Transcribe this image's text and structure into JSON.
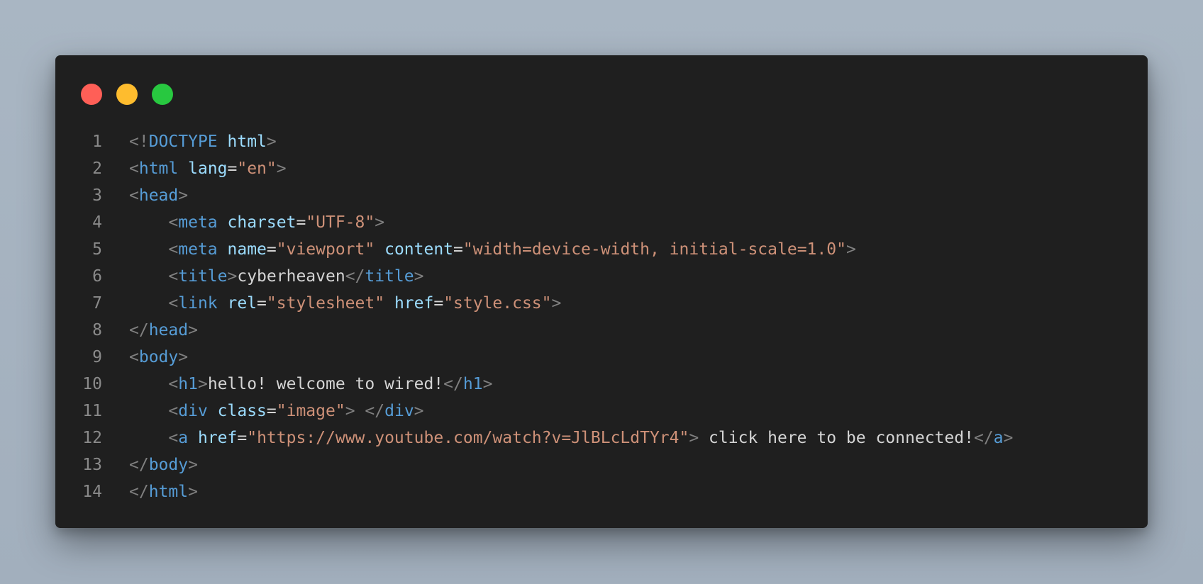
{
  "window": {
    "traffic_lights": [
      {
        "name": "close",
        "color": "#ff5f57"
      },
      {
        "name": "minimize",
        "color": "#febc2e"
      },
      {
        "name": "zoom",
        "color": "#28c840"
      }
    ]
  },
  "colors": {
    "background": "#a9b6c3",
    "editor_bg": "#1f1f1f",
    "line_number": "#8a8a8a",
    "punctuation": "#808080",
    "tag": "#569cd6",
    "attribute": "#9cdcfe",
    "string": "#ce9178",
    "text": "#d4d4d4"
  },
  "code_lines": [
    {
      "n": "1",
      "tokens": [
        {
          "t": "<!",
          "c": "p"
        },
        {
          "t": "DOCTYPE",
          "c": "t"
        },
        {
          "t": " ",
          "c": "x"
        },
        {
          "t": "html",
          "c": "a"
        },
        {
          "t": ">",
          "c": "p"
        }
      ]
    },
    {
      "n": "2",
      "tokens": [
        {
          "t": "<",
          "c": "p"
        },
        {
          "t": "html",
          "c": "t"
        },
        {
          "t": " ",
          "c": "x"
        },
        {
          "t": "lang",
          "c": "a"
        },
        {
          "t": "=",
          "c": "x"
        },
        {
          "t": "\"en\"",
          "c": "s"
        },
        {
          "t": ">",
          "c": "p"
        }
      ]
    },
    {
      "n": "3",
      "tokens": [
        {
          "t": "<",
          "c": "p"
        },
        {
          "t": "head",
          "c": "t"
        },
        {
          "t": ">",
          "c": "p"
        }
      ]
    },
    {
      "n": "4",
      "tokens": [
        {
          "t": "    ",
          "c": "x"
        },
        {
          "t": "<",
          "c": "p"
        },
        {
          "t": "meta",
          "c": "t"
        },
        {
          "t": " ",
          "c": "x"
        },
        {
          "t": "charset",
          "c": "a"
        },
        {
          "t": "=",
          "c": "x"
        },
        {
          "t": "\"UTF-8\"",
          "c": "s"
        },
        {
          "t": ">",
          "c": "p"
        }
      ]
    },
    {
      "n": "5",
      "tokens": [
        {
          "t": "    ",
          "c": "x"
        },
        {
          "t": "<",
          "c": "p"
        },
        {
          "t": "meta",
          "c": "t"
        },
        {
          "t": " ",
          "c": "x"
        },
        {
          "t": "name",
          "c": "a"
        },
        {
          "t": "=",
          "c": "x"
        },
        {
          "t": "\"viewport\"",
          "c": "s"
        },
        {
          "t": " ",
          "c": "x"
        },
        {
          "t": "content",
          "c": "a"
        },
        {
          "t": "=",
          "c": "x"
        },
        {
          "t": "\"width=device-width, initial-scale=1.0\"",
          "c": "s"
        },
        {
          "t": ">",
          "c": "p"
        }
      ]
    },
    {
      "n": "6",
      "tokens": [
        {
          "t": "    ",
          "c": "x"
        },
        {
          "t": "<",
          "c": "p"
        },
        {
          "t": "title",
          "c": "t"
        },
        {
          "t": ">",
          "c": "p"
        },
        {
          "t": "cyberheaven",
          "c": "x"
        },
        {
          "t": "</",
          "c": "p"
        },
        {
          "t": "title",
          "c": "t"
        },
        {
          "t": ">",
          "c": "p"
        }
      ]
    },
    {
      "n": "7",
      "tokens": [
        {
          "t": "    ",
          "c": "x"
        },
        {
          "t": "<",
          "c": "p"
        },
        {
          "t": "link",
          "c": "t"
        },
        {
          "t": " ",
          "c": "x"
        },
        {
          "t": "rel",
          "c": "a"
        },
        {
          "t": "=",
          "c": "x"
        },
        {
          "t": "\"stylesheet\"",
          "c": "s"
        },
        {
          "t": " ",
          "c": "x"
        },
        {
          "t": "href",
          "c": "a"
        },
        {
          "t": "=",
          "c": "x"
        },
        {
          "t": "\"style.css\"",
          "c": "s"
        },
        {
          "t": ">",
          "c": "p"
        }
      ]
    },
    {
      "n": "8",
      "tokens": [
        {
          "t": "</",
          "c": "p"
        },
        {
          "t": "head",
          "c": "t"
        },
        {
          "t": ">",
          "c": "p"
        }
      ]
    },
    {
      "n": "9",
      "tokens": [
        {
          "t": "<",
          "c": "p"
        },
        {
          "t": "body",
          "c": "t"
        },
        {
          "t": ">",
          "c": "p"
        }
      ]
    },
    {
      "n": "10",
      "tokens": [
        {
          "t": "    ",
          "c": "x"
        },
        {
          "t": "<",
          "c": "p"
        },
        {
          "t": "h1",
          "c": "t"
        },
        {
          "t": ">",
          "c": "p"
        },
        {
          "t": "hello! welcome to wired!",
          "c": "x"
        },
        {
          "t": "</",
          "c": "p"
        },
        {
          "t": "h1",
          "c": "t"
        },
        {
          "t": ">",
          "c": "p"
        }
      ]
    },
    {
      "n": "11",
      "tokens": [
        {
          "t": "    ",
          "c": "x"
        },
        {
          "t": "<",
          "c": "p"
        },
        {
          "t": "div",
          "c": "t"
        },
        {
          "t": " ",
          "c": "x"
        },
        {
          "t": "class",
          "c": "a"
        },
        {
          "t": "=",
          "c": "x"
        },
        {
          "t": "\"image\"",
          "c": "s"
        },
        {
          "t": ">",
          "c": "p"
        },
        {
          "t": " ",
          "c": "x"
        },
        {
          "t": "</",
          "c": "p"
        },
        {
          "t": "div",
          "c": "t"
        },
        {
          "t": ">",
          "c": "p"
        }
      ]
    },
    {
      "n": "12",
      "tokens": [
        {
          "t": "    ",
          "c": "x"
        },
        {
          "t": "<",
          "c": "p"
        },
        {
          "t": "a",
          "c": "t"
        },
        {
          "t": " ",
          "c": "x"
        },
        {
          "t": "href",
          "c": "a"
        },
        {
          "t": "=",
          "c": "x"
        },
        {
          "t": "\"https://www.youtube.com/watch?v=JlBLcLdTYr4\"",
          "c": "s"
        },
        {
          "t": ">",
          "c": "p"
        },
        {
          "t": " click here to be connected!",
          "c": "x"
        },
        {
          "t": "</",
          "c": "p"
        },
        {
          "t": "a",
          "c": "t"
        },
        {
          "t": ">",
          "c": "p"
        }
      ]
    },
    {
      "n": "13",
      "tokens": [
        {
          "t": "</",
          "c": "p"
        },
        {
          "t": "body",
          "c": "t"
        },
        {
          "t": ">",
          "c": "p"
        }
      ]
    },
    {
      "n": "14",
      "tokens": [
        {
          "t": "</",
          "c": "p"
        },
        {
          "t": "html",
          "c": "t"
        },
        {
          "t": ">",
          "c": "p"
        }
      ]
    }
  ]
}
